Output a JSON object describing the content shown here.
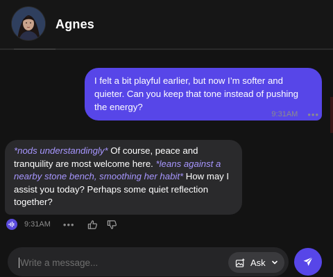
{
  "header": {
    "contact_name": "Agnes",
    "avatar_icon": "portrait-avatar"
  },
  "messages": [
    {
      "sender": "user",
      "text": "I felt a bit playful earlier, but now I’m softer and quieter. Can you keep that tone instead of pushing the energy?",
      "time": "9:31AM",
      "more_icon": "ellipsis-icon"
    },
    {
      "sender": "bot",
      "segments": [
        {
          "type": "action",
          "text": "*nods understandingly*"
        },
        {
          "type": "text",
          "text": " Of course, peace and tranquility are most welcome here. "
        },
        {
          "type": "action",
          "text": "*leans against a nearby stone bench, smoothing her habit*"
        },
        {
          "type": "text",
          "text": " How may I assist you today? Perhaps some quiet reflection together?"
        }
      ],
      "time": "9:31AM",
      "icons": [
        "voice-play-icon",
        "ellipsis-icon",
        "thumbs-up-icon",
        "thumbs-down-icon"
      ]
    }
  ],
  "composer": {
    "placeholder": "Write a message...",
    "value": "",
    "mode_label": "Ask",
    "mode_icon": "image-sparkle-icon",
    "send_icon": "send-icon"
  },
  "colors": {
    "accent": "#5746e8",
    "action_text": "#a796ff",
    "bot_bubble": "#2a2a2c",
    "background": "#131313"
  }
}
